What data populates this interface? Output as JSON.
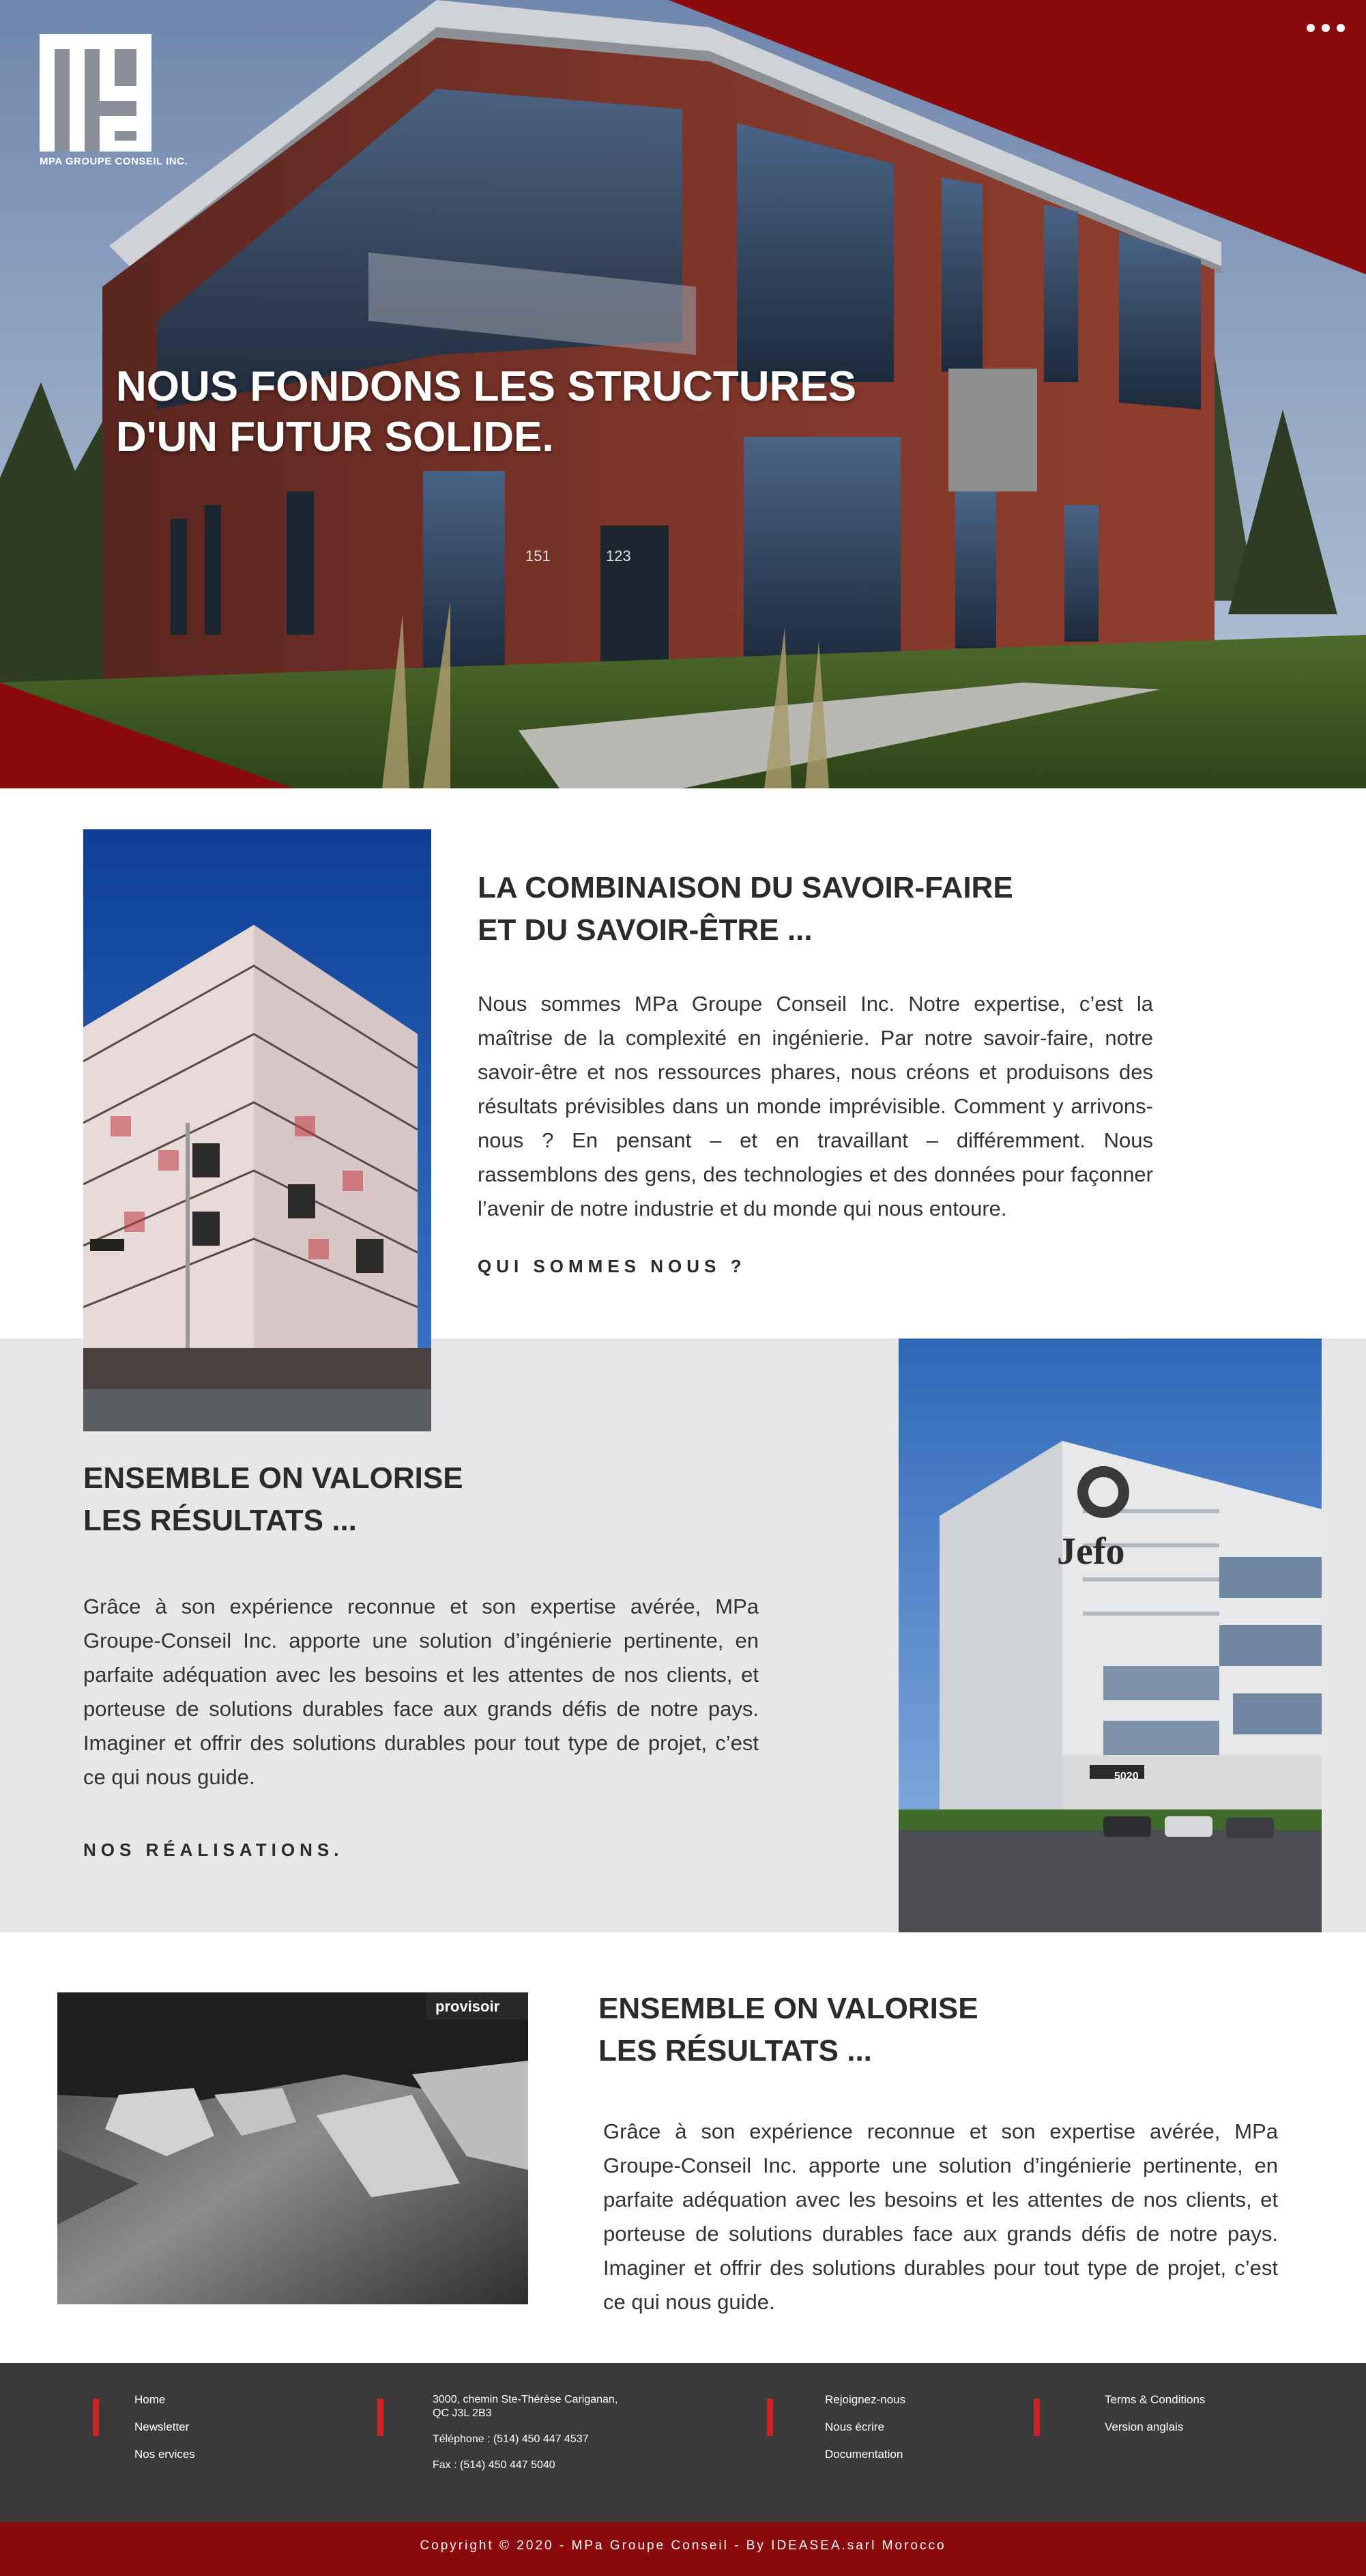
{
  "hero": {
    "logo_caption": "MPA GROUPE CONSEIL INC.",
    "title_line1": "NOUS FONDONS LES STRUCTURES",
    "title_line2": "D'UN FUTUR SOLIDE.",
    "building_numbers": [
      "151",
      "123"
    ],
    "menu_icon": "more-dots-icon"
  },
  "section1": {
    "title_line1": "LA COMBINAISON DU SAVOIR-FAIRE",
    "title_line2": "ET DU SAVOIR-ÊTRE ...",
    "body": "Nous sommes MPa Groupe Conseil Inc. Notre expertise, c’est la maîtrise de la complexité en ingénierie. Par notre savoir-faire, notre savoir-être et nos ressources phares, nous créons et produisons des résultats prévisibles dans un monde imprévisible. Comment y arrivons-nous ? En pensant – et en travaillant – différemment. Nous rassemblons des gens, des technologies et des données pour façonner l’avenir de notre industrie et du monde qui nous entoure.",
    "cta": "QUI SOMMES NOUS ?"
  },
  "section2": {
    "title_line1": "ENSEMBLE ON VALORISE",
    "title_line2": "LES RÉSULTATS ...",
    "body": "Grâce à son expérience reconnue et son expertise avérée, MPa Groupe-Conseil Inc. apporte une solution d’ingénierie pertinente, en parfaite adéquation avec les besoins et les attentes de nos clients, et porteuse de solutions durables face aux grands défis de notre pays. Imaginer et offrir des solutions durables pour tout type de projet, c’est ce qui nous guide.",
    "cta": "NOS RÉALISATIONS.",
    "photo_sign": "Jefo",
    "photo_number": "5020"
  },
  "section3": {
    "title_line1": "ENSEMBLE ON VALORISE",
    "title_line2": "LES RÉSULTATS ...",
    "body": "Grâce à son expérience reconnue et son expertise avérée, MPa Groupe-Conseil Inc. apporte une solution d’ingénierie pertinente, en parfaite adéquation avec les besoins et les attentes de nos clients, et porteuse de solutions durables face aux grands défis de notre pays. Imaginer et offrir des solutions durables pour tout type de projet, c’est ce qui nous guide.",
    "photo_badge": "provisoir"
  },
  "footer": {
    "col1": [
      "Home",
      "Newsletter",
      "Nos ervices"
    ],
    "col2": {
      "address_line1": "3000, chemin Ste-Thérèse Cariganan,",
      "address_line2": "QC J3L 2B3",
      "phone": "Téléphone : (514) 450 447 4537",
      "fax": "Fax : (514) 450 447 5040"
    },
    "col3": [
      "Rejoignez-nous",
      "Nous écrire",
      "Documentation"
    ],
    "col4": [
      "Terms & Conditions",
      "Version anglais"
    ],
    "copyright": "Copyright © 2020 - MPa Groupe Conseil - By IDEASEA.sarl Morocco"
  },
  "colors": {
    "brand_red": "#8b0a0b",
    "accent_red": "#d12127",
    "footer_bg": "#3a3a3a",
    "band_grey": "#e7e7e7"
  }
}
